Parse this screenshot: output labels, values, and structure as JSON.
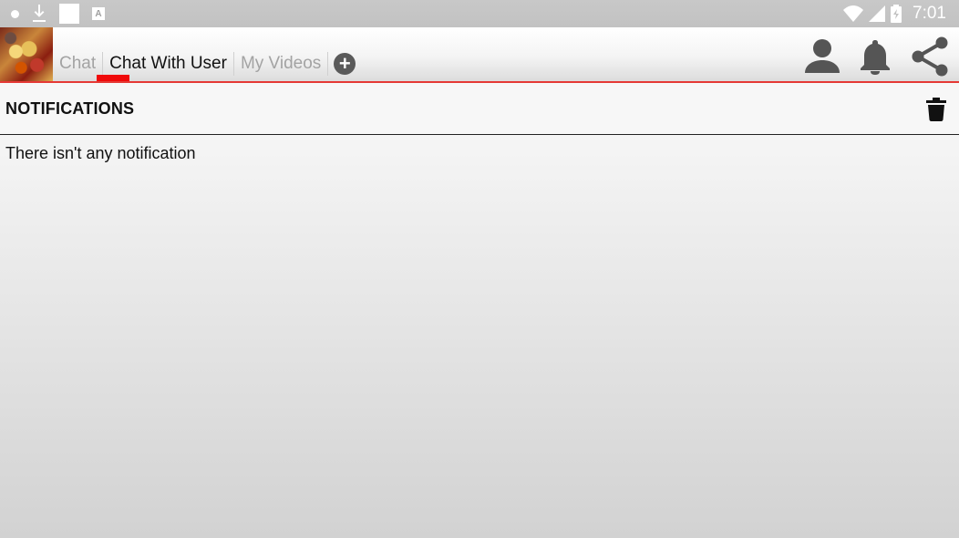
{
  "status_bar": {
    "time": "7:01",
    "icons": [
      "notification-dot-icon",
      "download-icon",
      "app-square-icon",
      "a-icon",
      "wifi-icon",
      "signal-icon",
      "battery-icon"
    ]
  },
  "app_bar": {
    "logo": "app-logo",
    "tabs": [
      {
        "label": "Chat",
        "active": false
      },
      {
        "label": "Chat With User",
        "active": true
      },
      {
        "label": "My Videos",
        "active": false
      }
    ],
    "add_tab_icon": "add-circle-icon",
    "actions": [
      "profile-icon",
      "bell-icon",
      "share-icon"
    ],
    "accent_color": "#e53935"
  },
  "notifications": {
    "title": "NOTIFICATIONS",
    "delete_icon": "trash-icon",
    "empty_message": "There isn't any notification"
  }
}
